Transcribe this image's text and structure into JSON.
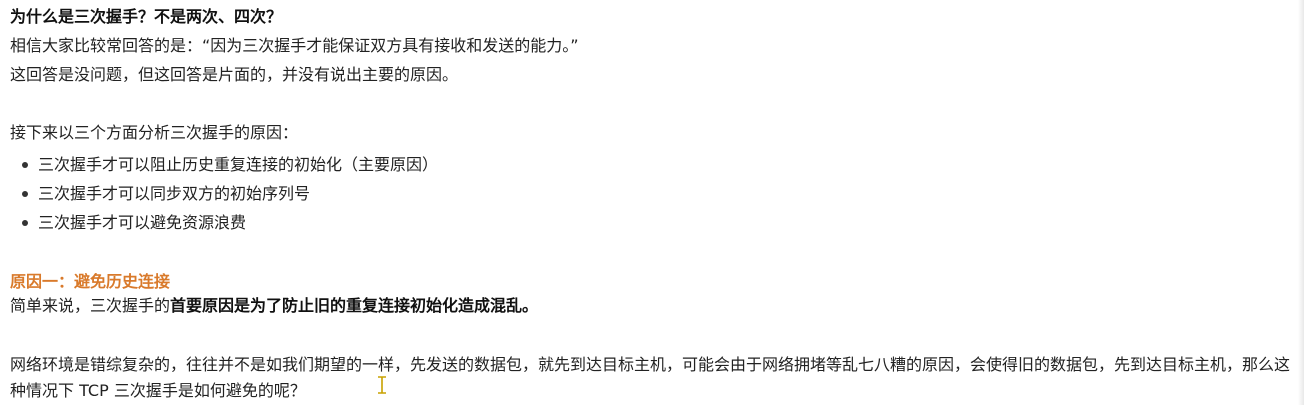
{
  "article": {
    "heading": "为什么是三次握手？不是两次、四次？",
    "intro_line1": "相信大家比较常回答的是：“因为三次握手才能保证双方具有接收和发送的能力。”",
    "intro_line2": "这回答是没问题，但这回答是片面的，并没有说出主要的原因。",
    "analysis_intro": "接下来以三个方面分析三次握手的原因：",
    "reasons": [
      "三次握手才可以阻止历史重复连接的初始化（主要原因）",
      "三次握手才可以同步双方的初始序列号",
      "三次握手才可以避免资源浪费"
    ],
    "reason1_heading": "原因一：避免历史连接",
    "reason1_summary_prefix": "简单来说，三次握手的",
    "reason1_summary_bold": "首要原因是为了防止旧的重复连接初始化造成混乱。",
    "reason1_paragraph": "网络环境是错综复杂的，往往并不是如我们期望的一样，先发送的数据包，就先到达目标主机，可能会由于网络拥堵等乱七八糟的原因，会使得旧的数据包，先到达目标主机，那么这种情况下 TCP 三次握手是如何避免的呢？"
  },
  "colors": {
    "accent": "#d97a2b",
    "text": "#222222"
  },
  "icons": {
    "cursor": "text-cursor-icon"
  }
}
